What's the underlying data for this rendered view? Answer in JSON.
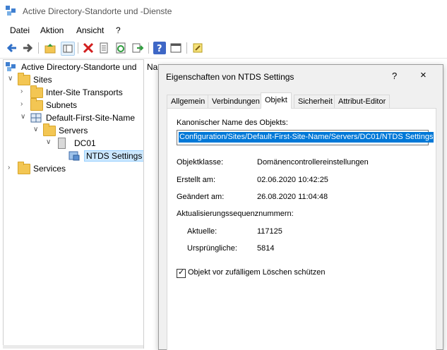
{
  "window": {
    "title": "Active Directory-Standorte und -Dienste"
  },
  "menu": [
    "Datei",
    "Aktion",
    "Ansicht",
    "?"
  ],
  "toolbar": [
    "back-arrow-icon",
    "forward-arrow-icon",
    "up-folder-icon",
    "show-tree-icon",
    "delete-icon",
    "properties-icon",
    "refresh-icon",
    "export-icon",
    "help-icon",
    "console-icon",
    "new-icon"
  ],
  "tree": {
    "root": "Active Directory-Standorte und",
    "sites": "Sites",
    "inter_site": "Inter-Site Transports",
    "subnets": "Subnets",
    "default_site": "Default-First-Site-Name",
    "servers": "Servers",
    "dc01": "DC01",
    "ntds": "NTDS Settings",
    "services": "Services"
  },
  "list": {
    "column_name": "Na"
  },
  "dialog": {
    "title": "Eigenschaften von NTDS Settings",
    "help": "?",
    "close": "×",
    "tabs": [
      "Allgemein",
      "Verbindungen",
      "Objekt",
      "Sicherheit",
      "Attribut-Editor"
    ],
    "active_tab": "Objekt",
    "canonical_label": "Kanonischer Name des Objekts:",
    "canonical_value": "Configuration/Sites/Default-First-Site-Name/Servers/DC01/NTDS Settings",
    "class_label": "Objektklasse:",
    "class_value": "Domänencontrollereinstellungen",
    "created_label": "Erstellt am:",
    "created_value": "02.06.2020 10:42:25",
    "modified_label": "Geändert am:",
    "modified_value": "26.08.2020 11:04:48",
    "usn_label": "Aktualisierungssequenznummern:",
    "current_label": "Aktuelle:",
    "current_value": "117125",
    "original_label": "Ursprüngliche:",
    "original_value": "5814",
    "protect_label": "Objekt vor zufälligem Löschen schützen",
    "protect_checked": "✓"
  },
  "colors": {
    "selection": "#0078d7",
    "tree_selected": "#cce8ff",
    "folder": "#f3c653"
  }
}
